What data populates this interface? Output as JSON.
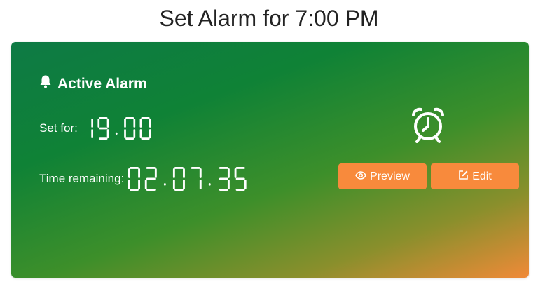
{
  "page": {
    "title": "Set Alarm for 7:00 PM"
  },
  "card": {
    "header": "Active Alarm",
    "set_for_label": "Set for:",
    "set_for_value": "19:00",
    "remaining_label": "Time remaining:",
    "remaining_value": "02:07:35",
    "preview_label": "Preview",
    "edit_label": "Edit",
    "icons": {
      "header": "bell-icon",
      "clock": "alarm-clock-icon",
      "preview": "eye-icon",
      "edit": "edit-icon"
    }
  },
  "colors": {
    "gradient_start": "#0e7a45",
    "gradient_end": "#f08a38",
    "button": "#f88a3c"
  }
}
